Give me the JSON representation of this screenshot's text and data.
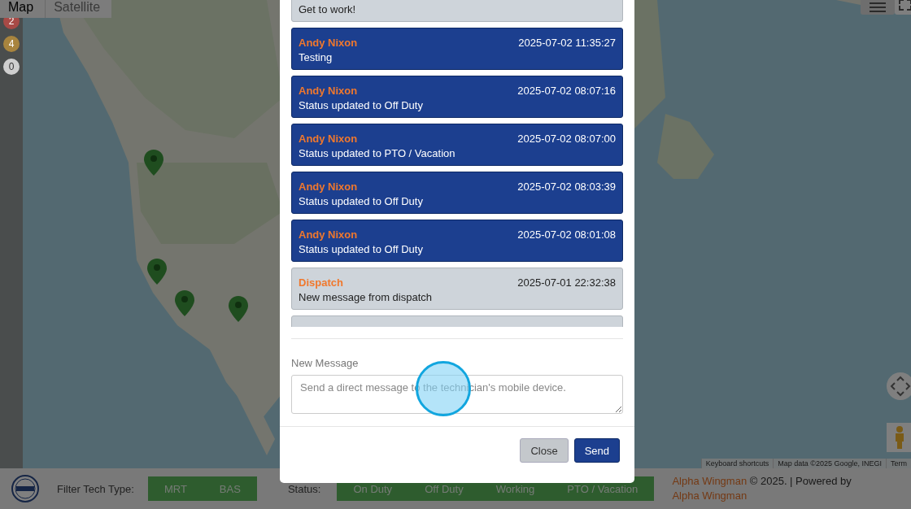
{
  "map_type_tabs": [
    {
      "label": "Map",
      "selected": true
    },
    {
      "label": "Satellite",
      "selected": false
    }
  ],
  "status_badges": [
    {
      "count": "2",
      "color": "#a84a46"
    },
    {
      "count": "4",
      "color": "#a8843e"
    },
    {
      "count": "0",
      "color": "#cfcfcf"
    }
  ],
  "map": {
    "kind": "picture",
    "attribution": [
      "Keyboard shortcuts",
      "Map data ©2025 Google, INEGI",
      "Term"
    ]
  },
  "modal": {
    "messages": [
      {
        "kind": "dispatch",
        "body": "Get to work!"
      },
      {
        "kind": "technician",
        "sender": "Andy Nixon",
        "time": "2025-07-02 11:35:27",
        "body": "Testing"
      },
      {
        "kind": "technician",
        "sender": "Andy Nixon",
        "time": "2025-07-02 08:07:16",
        "body": "Status updated to Off Duty"
      },
      {
        "kind": "technician",
        "sender": "Andy Nixon",
        "time": "2025-07-02 08:07:00",
        "body": "Status updated to PTO / Vacation"
      },
      {
        "kind": "technician",
        "sender": "Andy Nixon",
        "time": "2025-07-02 08:03:39",
        "body": "Status updated to Off Duty"
      },
      {
        "kind": "technician",
        "sender": "Andy Nixon",
        "time": "2025-07-02 08:01:08",
        "body": "Status updated to Off Duty"
      },
      {
        "kind": "dispatch",
        "sender": "Dispatch",
        "time": "2025-07-01 22:32:38",
        "body": "New message from dispatch"
      },
      {
        "kind": "dispatch"
      }
    ],
    "new_message_label": "New Message",
    "placeholder": "Send a direct message to the technician's mobile device.",
    "buttons": [
      {
        "label": "Close",
        "kind": "secondary"
      },
      {
        "label": "Send",
        "kind": "primary"
      }
    ]
  },
  "footer": {
    "filter_label": "Filter Tech Type:",
    "tech_types": [
      "MRT",
      "BAS"
    ],
    "status_label": "Status:",
    "statuses": [
      "On Duty",
      "Off Duty",
      "Working",
      "PTO / Vacation"
    ],
    "link_1": "Alpha Wingman",
    "text": "© 2025. | Powered by",
    "link_2": "Alpha Wingman"
  }
}
